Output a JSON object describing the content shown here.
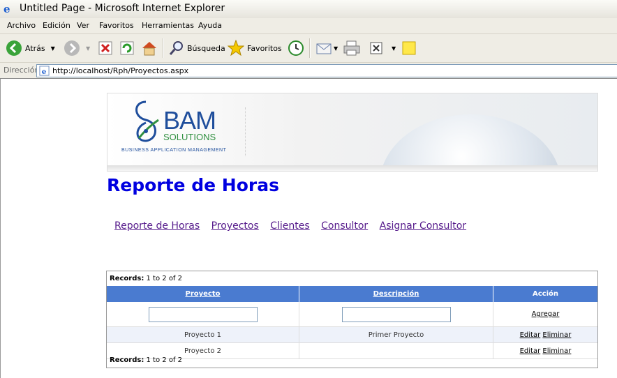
{
  "window": {
    "title": "Untitled Page - Microsoft Internet Explorer"
  },
  "menu": [
    "Archivo",
    "Edición",
    "Ver",
    "Favoritos",
    "Herramientas",
    "Ayuda"
  ],
  "toolbar": {
    "back": "Atrás",
    "search": "Búsqueda",
    "favorites": "Favoritos"
  },
  "address": {
    "label": "Dirección",
    "url": "http://localhost/Rph/Proyectos.aspx"
  },
  "banner": {
    "brand": "BAM",
    "sub": "SOLUTIONS",
    "tagline": "BUSINESS APPLICATION MANAGEMENT"
  },
  "page": {
    "heading": "Reporte de Horas"
  },
  "nav": [
    "Reporte de Horas",
    "Proyectos",
    "Clientes",
    "Consultor",
    "Asignar Consultor"
  ],
  "grid": {
    "records_label": "Records:",
    "records_text": "1 to 2 of 2",
    "columns": [
      "Proyecto",
      "Descripción",
      "Acción"
    ],
    "add_label": "Agregar",
    "rows": [
      {
        "proyecto": "Proyecto 1",
        "descripcion": "Primer Proyecto",
        "edit": "Editar",
        "delete": "Eliminar"
      },
      {
        "proyecto": "Proyecto 2",
        "descripcion": "",
        "edit": "Editar",
        "delete": "Eliminar"
      }
    ]
  },
  "colors": {
    "header_bg": "#4a7bd0",
    "heading": "#0000e0",
    "link_visited": "#551a8b"
  }
}
